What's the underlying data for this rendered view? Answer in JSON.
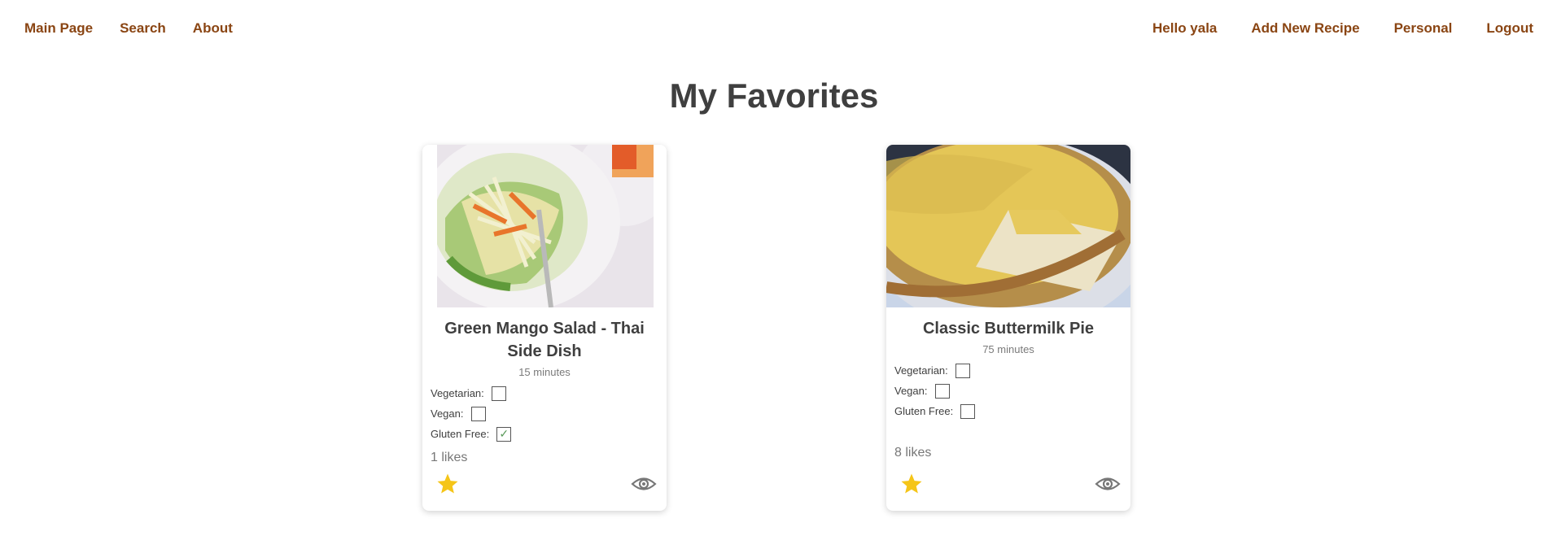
{
  "nav": {
    "left": [
      "Main Page",
      "Search",
      "About"
    ],
    "right": [
      "Hello yala",
      "Add New Recipe",
      "Personal",
      "Logout"
    ]
  },
  "page_title": "My Favorites",
  "recipes": [
    {
      "title": "Green Mango Salad - Thai Side Dish",
      "time": "15 minutes",
      "vegetarian_label": "Vegetarian:",
      "vegan_label": "Vegan:",
      "gluten_free_label": "Gluten Free:",
      "vegetarian": false,
      "vegan": false,
      "gluten_free": true,
      "likes": "1 likes"
    },
    {
      "title": "Classic Buttermilk Pie",
      "time": "75 minutes",
      "vegetarian_label": "Vegetarian:",
      "vegan_label": "Vegan:",
      "gluten_free_label": "Gluten Free:",
      "vegetarian": false,
      "vegan": false,
      "gluten_free": false,
      "likes": "8 likes"
    }
  ],
  "icons": {
    "favorite": "star-icon",
    "view": "eye-icon"
  },
  "colors": {
    "nav_link": "#8a4513",
    "star": "#f5c518",
    "heading": "#3f3f3f"
  }
}
